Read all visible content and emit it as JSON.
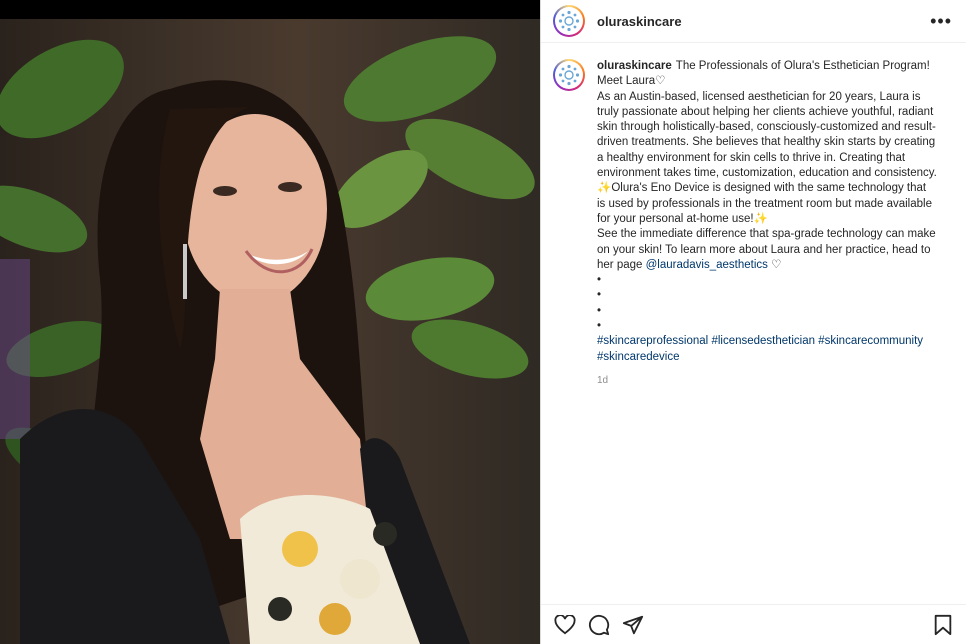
{
  "post": {
    "username": "oluraskincare",
    "more_label": "•••",
    "caption_username": "oluraskincare",
    "caption_lines": {
      "l1": "The Professionals of Olura's Esthetician Program!",
      "l2": "Meet Laura♡",
      "l3": "As an Austin-based, licensed aesthetician for 20 years, Laura is truly passionate about helping her clients achieve youthful, radiant skin through holistically-based, consciously-customized and result-driven treatments. She believes that healthy skin starts by creating a healthy environment for skin cells to thrive in. Creating that environment takes time, customization, education and consistency.",
      "l4": "✨Olura's Eno Device is designed with the same technology that is used by professionals in the treatment room but made available for your personal at-home use!✨",
      "l5": "See the immediate difference that spa-grade technology can make on your skin! To learn more about Laura and her practice, head to her page",
      "mention": "@lauradavis_aesthetics",
      "heart_after_mention": "♡",
      "bullets": [
        "•",
        "•",
        "•",
        "•"
      ],
      "hashtags": [
        "#skincareprofessional",
        "#licensedesthetician",
        "#skincarecommunity",
        "#skincaredevice"
      ]
    },
    "time_ago": "1d"
  },
  "icons": {
    "like": "heart-icon",
    "comment": "comment-icon",
    "share": "send-icon",
    "save": "bookmark-icon"
  },
  "colors": {
    "link": "#00376b",
    "muted": "#8e8e8e",
    "avatar_ring": [
      "#feda75",
      "#fa7e1e",
      "#d62976",
      "#962fbf",
      "#4f5bd5"
    ]
  }
}
